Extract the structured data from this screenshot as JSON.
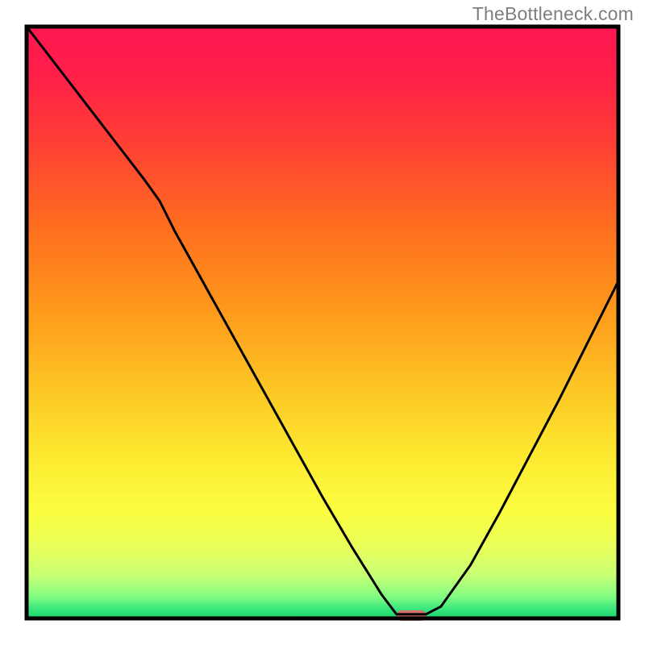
{
  "watermark": "TheBottleneck.com",
  "chart_data": {
    "type": "line",
    "title": "",
    "xlabel": "",
    "ylabel": "",
    "x": [
      0.0,
      0.05,
      0.1,
      0.15,
      0.2,
      0.225,
      0.25,
      0.3,
      0.35,
      0.4,
      0.45,
      0.5,
      0.55,
      0.6,
      0.625,
      0.675,
      0.7,
      0.75,
      0.8,
      0.85,
      0.9,
      0.95,
      1.0
    ],
    "values": [
      100,
      93.5,
      87.0,
      80.5,
      74.0,
      70.5,
      65.5,
      56.5,
      47.5,
      38.5,
      29.5,
      20.5,
      12.0,
      4.0,
      0.7,
      0.7,
      2.0,
      9.0,
      18.0,
      27.5,
      37.0,
      47.0,
      57.0
    ],
    "xlim": [
      0,
      1
    ],
    "ylim": [
      0,
      100
    ],
    "marker": {
      "x": 0.65,
      "width": 0.05
    },
    "gradient_stops": [
      {
        "offset": 0.0,
        "color": "#ff1752"
      },
      {
        "offset": 0.08,
        "color": "#ff1f49"
      },
      {
        "offset": 0.2,
        "color": "#ff4034"
      },
      {
        "offset": 0.34,
        "color": "#ff6e1f"
      },
      {
        "offset": 0.48,
        "color": "#fe991b"
      },
      {
        "offset": 0.6,
        "color": "#fdc224"
      },
      {
        "offset": 0.72,
        "color": "#fde82f"
      },
      {
        "offset": 0.82,
        "color": "#fbfe40"
      },
      {
        "offset": 0.88,
        "color": "#eaff5c"
      },
      {
        "offset": 0.93,
        "color": "#c3ff74"
      },
      {
        "offset": 0.965,
        "color": "#7cfc83"
      },
      {
        "offset": 0.985,
        "color": "#36e57c"
      },
      {
        "offset": 1.0,
        "color": "#1bd36b"
      }
    ],
    "frame_color": "#000000",
    "curve_color": "#000000",
    "marker_color": "#d9706a"
  }
}
